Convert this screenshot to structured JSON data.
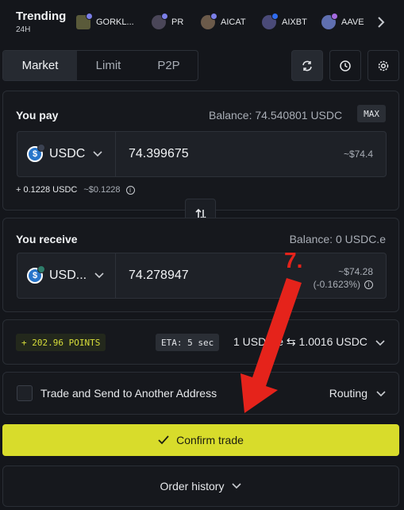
{
  "trending": {
    "title": "Trending",
    "period": "24H",
    "items": [
      {
        "label": "GORKL...",
        "icon": "gorkl-token-icon"
      },
      {
        "label": "PR",
        "icon": "pr-token-icon"
      },
      {
        "label": "AICAT",
        "icon": "aicat-token-icon"
      },
      {
        "label": "AIXBT",
        "icon": "aixbt-token-icon"
      },
      {
        "label": "AAVE",
        "icon": "aave-token-icon"
      }
    ]
  },
  "tabs": [
    {
      "label": "Market",
      "active": true
    },
    {
      "label": "Limit",
      "active": false
    },
    {
      "label": "P2P",
      "active": false
    }
  ],
  "toolbar_icons": [
    "refresh-icon",
    "clock-icon",
    "settings-gear-icon"
  ],
  "pay": {
    "label": "You pay",
    "balance": "Balance: 74.540801  USDC",
    "max_label": "MAX",
    "token": "USDC",
    "amount": "74.399675",
    "usd_value": "~$74.4",
    "fee_amount": "+ 0.1228 USDC",
    "fee_usd": "~$0.1228"
  },
  "receive": {
    "label": "You receive",
    "balance": "Balance: 0 USDC.e",
    "token": "USD...",
    "amount": "74.278947",
    "usd_value": "~$74.28",
    "price_impact": "(-0.1623%)"
  },
  "route": {
    "points": "+ 202.96 POINTS",
    "eta": "ETA: 5 sec",
    "rate": "1 USDC.e ⇆ 1.0016 USDC"
  },
  "options": {
    "send_to_address_label": "Trade and Send to Another Address",
    "routing_label": "Routing"
  },
  "confirm_label": "Confirm trade",
  "order_history_label": "Order history",
  "annotation": {
    "step_label": "7.",
    "color": "#e5231b"
  },
  "colors": {
    "accent": "#d8dc2b",
    "background": "#14161b",
    "points": "#d8de3a"
  }
}
